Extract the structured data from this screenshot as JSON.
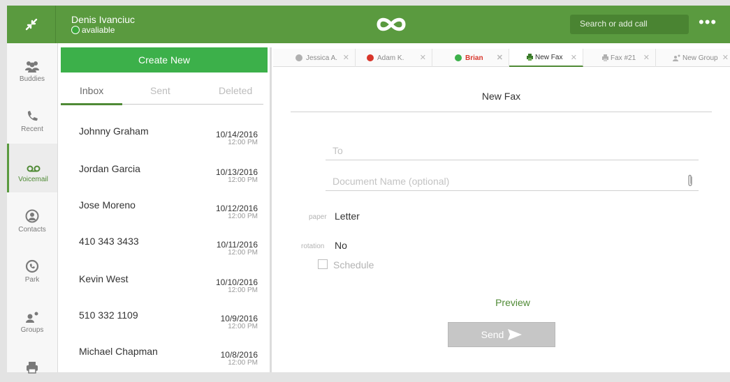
{
  "user": {
    "name": "Denis Ivanciuc",
    "status": "avaliable"
  },
  "search": {
    "placeholder": "Search or add call"
  },
  "nav": [
    {
      "label": "Buddies",
      "icon": "buddies-icon"
    },
    {
      "label": "Recent",
      "icon": "phone-icon"
    },
    {
      "label": "Voicemail",
      "icon": "voicemail-icon"
    },
    {
      "label": "Contacts",
      "icon": "contact-icon"
    },
    {
      "label": "Park",
      "icon": "park-icon"
    },
    {
      "label": "Groups",
      "icon": "groups-icon"
    },
    {
      "label": "",
      "icon": "fax-icon"
    }
  ],
  "panel": {
    "create_label": "Create New",
    "tabs": [
      "Inbox",
      "Sent",
      "Deleted"
    ],
    "rows": [
      {
        "name": "Johnny Graham",
        "date": "10/14/2016",
        "time": "12:00 PM"
      },
      {
        "name": "Jordan Garcia",
        "date": "10/13/2016",
        "time": "12:00 PM"
      },
      {
        "name": "Jose Moreno",
        "date": "10/12/2016",
        "time": "12:00 PM"
      },
      {
        "name": "410 343 3433",
        "date": "10/11/2016",
        "time": "12:00 PM"
      },
      {
        "name": "Kevin West",
        "date": "10/10/2016",
        "time": "12:00 PM"
      },
      {
        "name": "510 332 1109",
        "date": "10/9/2016",
        "time": "12:00 PM"
      },
      {
        "name": "Michael Chapman",
        "date": "10/8/2016",
        "time": "12:00 PM"
      }
    ]
  },
  "conv_tabs": [
    {
      "label": "Jessica A.",
      "dot_color": "#b0b0b0"
    },
    {
      "label": "Adam K.",
      "dot_color": "#d8352a"
    },
    {
      "label": "Brian",
      "dot_color": "#3cb04a"
    },
    {
      "label": "New Fax",
      "icon": "fax-icon"
    },
    {
      "label": "Fax #21",
      "icon": "fax-icon"
    },
    {
      "label": "New Group",
      "icon": "group-icon"
    }
  ],
  "fax": {
    "title": "New Fax",
    "to_placeholder": "To",
    "doc_placeholder": "Document Name (optional)",
    "paper_label": "paper",
    "paper_value": "Letter",
    "rotation_label": "rotation",
    "rotation_value": "No",
    "schedule_label": "Schedule",
    "preview_label": "Preview",
    "send_label": "Send"
  },
  "colors": {
    "brand_green": "#5a9a3f",
    "create_green": "#3cb04a",
    "accent": "#4f8a35"
  }
}
